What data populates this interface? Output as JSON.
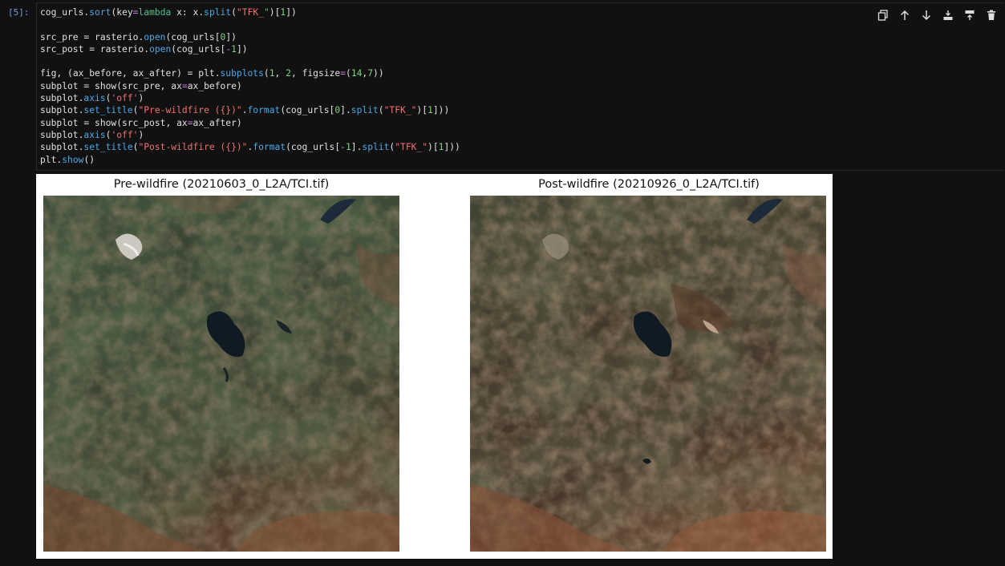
{
  "cell": {
    "prompt": "[5]:",
    "code_lines": [
      "cog_urls.sort(key=lambda x: x.split(\"TFK_\")[1])",
      "",
      "src_pre = rasterio.open(cog_urls[0])",
      "src_post = rasterio.open(cog_urls[-1])",
      "",
      "fig, (ax_before, ax_after) = plt.subplots(1, 2, figsize=(14,7))",
      "subplot = show(src_pre, ax=ax_before)",
      "subplot.axis('off')",
      "subplot.set_title(\"Pre-wildfire ({})\".format(cog_urls[0].split(\"TFK_\")[1]))",
      "subplot = show(src_post, ax=ax_after)",
      "subplot.axis('off')",
      "subplot.set_title(\"Post-wildfire ({})\".format(cog_urls[-1].split(\"TFK_\")[1]))",
      "plt.show()"
    ]
  },
  "toolbar": {
    "icons": [
      "duplicate-icon",
      "move-up-icon",
      "move-down-icon",
      "insert-below-icon",
      "insert-above-icon",
      "delete-icon"
    ]
  },
  "output": {
    "pre_title": "Pre-wildfire (20210603_0_L2A/TCI.tif)",
    "post_title": "Post-wildfire (20210926_0_L2A/TCI.tif)"
  },
  "colors": {
    "background": "#111111",
    "prompt": "#6fa0d8",
    "code_text": "#e0e0e0",
    "method": "#4aa8e8",
    "keyword": "#4fc08d",
    "string": "#f07070",
    "number": "#7ed37e",
    "operator": "#c678dd"
  }
}
